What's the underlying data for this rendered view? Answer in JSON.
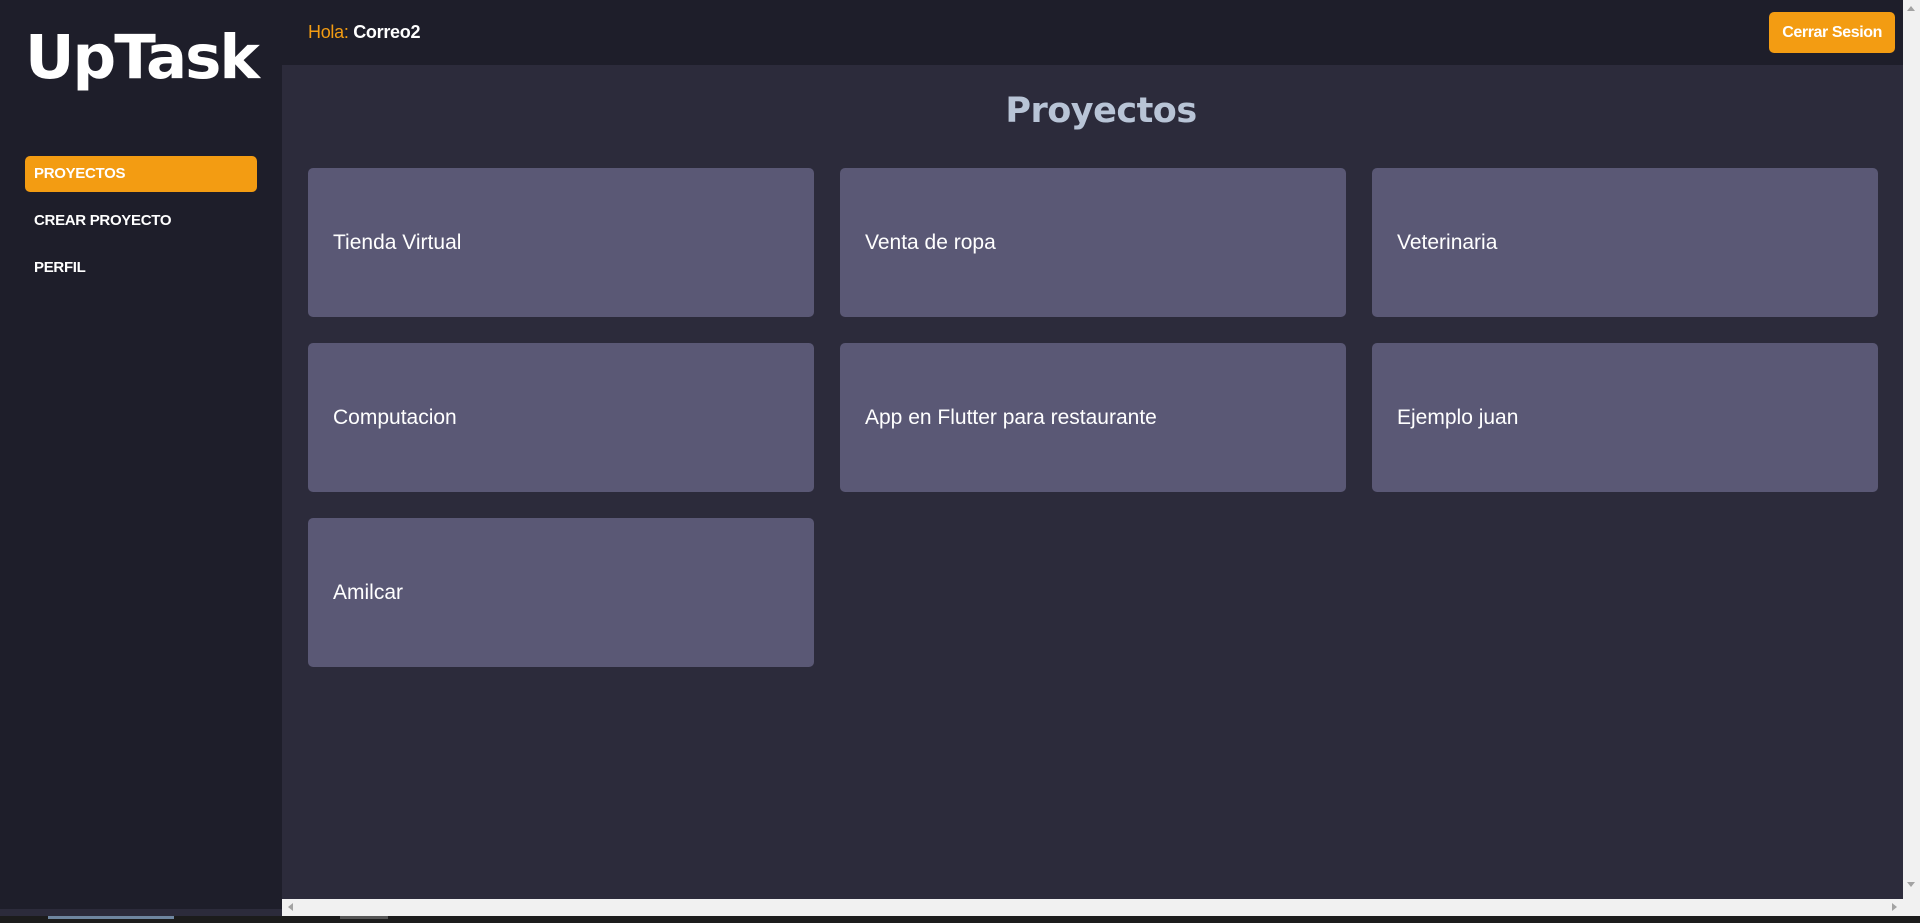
{
  "app": {
    "logo": "UpTask"
  },
  "sidebar": {
    "items": [
      {
        "label": "PROYECTOS",
        "active": true
      },
      {
        "label": "CREAR PROYECTO",
        "active": false
      },
      {
        "label": "PERFIL",
        "active": false
      }
    ]
  },
  "header": {
    "greeting_prefix": "Hola:",
    "username": "Correo2",
    "logout_label": "Cerrar Sesion"
  },
  "main": {
    "title": "Proyectos",
    "projects": [
      {
        "name": "Tienda Virtual"
      },
      {
        "name": "Venta de ropa"
      },
      {
        "name": "Veterinaria"
      },
      {
        "name": "Computacion"
      },
      {
        "name": "App en Flutter para restaurante"
      },
      {
        "name": "Ejemplo juan"
      },
      {
        "name": "Amilcar"
      }
    ]
  },
  "colors": {
    "accent": "#f39c12",
    "sidebar_bg": "#1e1e2a",
    "main_bg": "#2c2b3b",
    "card_bg": "#5a5875",
    "title_color": "#b8c4d6"
  }
}
